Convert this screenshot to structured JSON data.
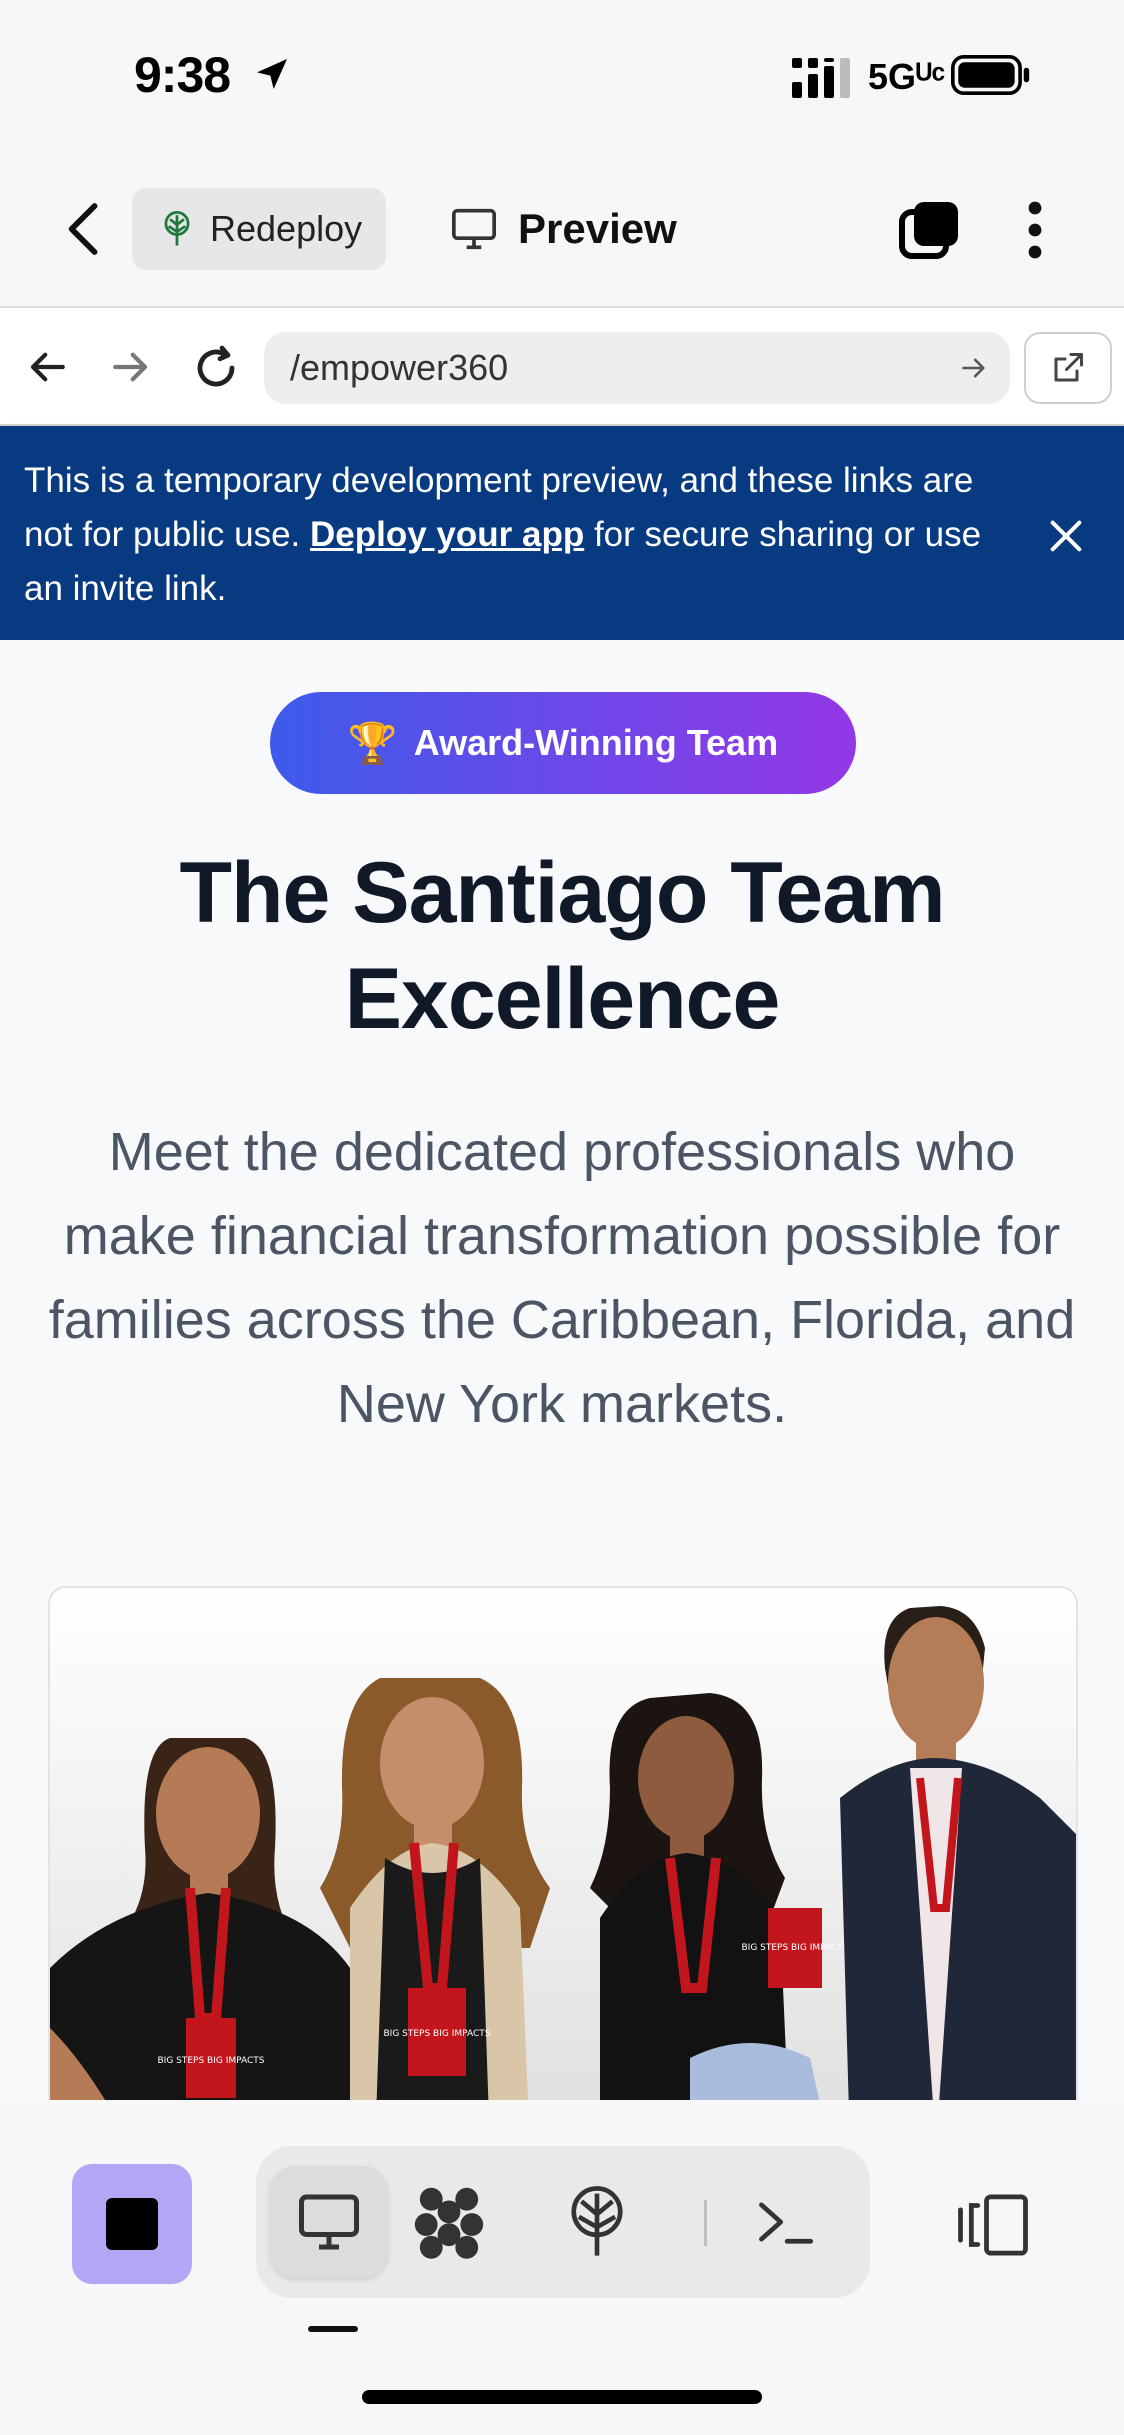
{
  "status_bar": {
    "time": "9:38",
    "network": "5Gᵁᶜ",
    "icons": [
      "location-arrow-icon",
      "signal-icon",
      "battery-icon"
    ]
  },
  "toolbar": {
    "back_icon": "chevron-left-icon",
    "redeploy_label": "Redeploy",
    "preview_label": "Preview",
    "tabs_icon": "tabs-icon",
    "menu_icon": "kebab-menu-icon"
  },
  "url_bar": {
    "url": "/empower360",
    "icons": [
      "arrow-left-icon",
      "arrow-right-icon",
      "reload-icon",
      "external-link-icon"
    ]
  },
  "banner": {
    "text_before": "This is a temporary development preview, and these links are not for public use. ",
    "link_text": "Deploy your app",
    "text_after": " for secure sharing or use an invite link.",
    "background": "#073a80"
  },
  "hero": {
    "badge_icon": "🏆",
    "badge_label": "Award-Winning Team",
    "title": "The Santiago Team Excellence",
    "subtitle": "Meet the dedicated professionals who make financial transformation possible for families across the Caribbean, Florida, and New York markets."
  },
  "badge_text": {
    "lanyard": "BIG STEPS BIG IMPACTS"
  },
  "bottom_bar": {
    "accent": "#b3a6f7",
    "items": [
      "stop-icon",
      "desktop-icon",
      "agent-icon",
      "deploy-icon",
      "terminal-icon",
      "panel-icon"
    ],
    "active": "desktop-icon"
  }
}
